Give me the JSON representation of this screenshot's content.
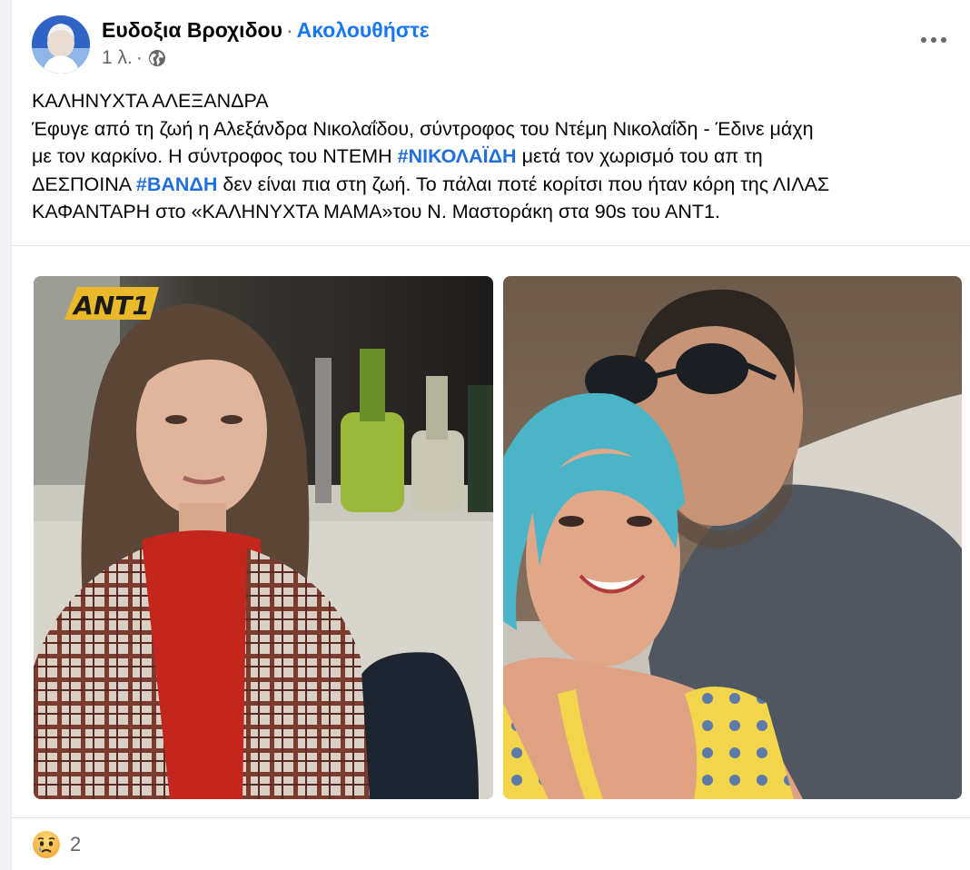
{
  "post": {
    "author": "Ευδοξια Βροχιδου",
    "separator": "·",
    "follow_label": "Ακολουθήστε",
    "time": "1 λ.",
    "time_separator": "·",
    "audience_icon": "globe-icon",
    "more_icon": "more-options-icon",
    "text_lines": [
      {
        "segments": [
          {
            "text": "ΚΑΛΗΝΥΧΤΑ ΑΛΕΞΑΝΔΡΑ"
          }
        ]
      },
      {
        "segments": [
          {
            "text": "Έφυγε από τη ζωή η Αλεξάνδρα Νικολαΐδου, σύντροφος του Ντέμη Νικολαΐδη - Έδινε μάχη"
          }
        ]
      },
      {
        "segments": [
          {
            "text": "με τον καρκίνο. Η σύντροφος του ΝΤΕΜΗ "
          },
          {
            "text": "#ΝΙΚΟΛΑΪΔΗ",
            "hashtag": true
          },
          {
            "text": " μετά τον χωρισμό του απ τη"
          }
        ]
      },
      {
        "segments": [
          {
            "text": "ΔΕΣΠΟΙΝΑ "
          },
          {
            "text": "#ΒΑΝΔΗ",
            "hashtag": true
          },
          {
            "text": " δεν είναι πια στη ζωή. Το πάλαι ποτέ κορίτσι που ήταν κόρη της ΛΙΛΑΣ"
          }
        ]
      },
      {
        "segments": [
          {
            "text": "ΚΑΦΑΝΤΑΡΗ στο «ΚΑΛΗΝΥΧΤΑ ΜΑΜΑ»του Ν. Μαστοράκη στα 90s του ΑΝΤ1."
          }
        ]
      }
    ],
    "photo_left_logo": "ANT1",
    "reaction_icon": "sad-reaction-icon",
    "reaction_count": "2"
  },
  "colors": {
    "link": "#1877f2",
    "hashtag": "#216fdb",
    "secondary_text": "#65676b",
    "divider": "#e4e6eb"
  }
}
